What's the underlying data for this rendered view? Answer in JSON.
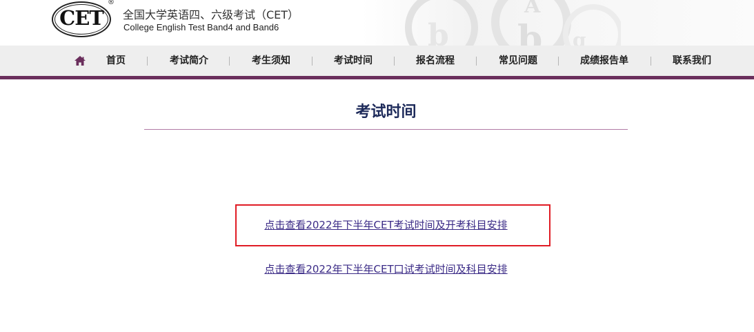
{
  "header": {
    "logo_text": "CET",
    "logo_mark": "®",
    "title_cn": "全国大学英语四、六级考试（CET）",
    "title_en": "College English Test Band4 and Band6"
  },
  "nav": {
    "home_icon": "home-icon",
    "items": [
      {
        "label": "首页"
      },
      {
        "label": "考试简介"
      },
      {
        "label": "考生须知"
      },
      {
        "label": "考试时间"
      },
      {
        "label": "报名流程"
      },
      {
        "label": "常见问题"
      },
      {
        "label": "成绩报告单"
      },
      {
        "label": "联系我们"
      }
    ]
  },
  "main": {
    "heading": "考试时间",
    "links": [
      {
        "label": "点击查看2022年下半年CET考试时间及开考科目安排",
        "highlighted": true
      },
      {
        "label": "点击查看2022年下半年CET口试考试时间及科目安排",
        "highlighted": false
      }
    ]
  },
  "colors": {
    "nav_accent": "#6a2e5c",
    "heading": "#1d2a5a",
    "link": "#3a2a86",
    "highlight_border": "#e01b24"
  }
}
